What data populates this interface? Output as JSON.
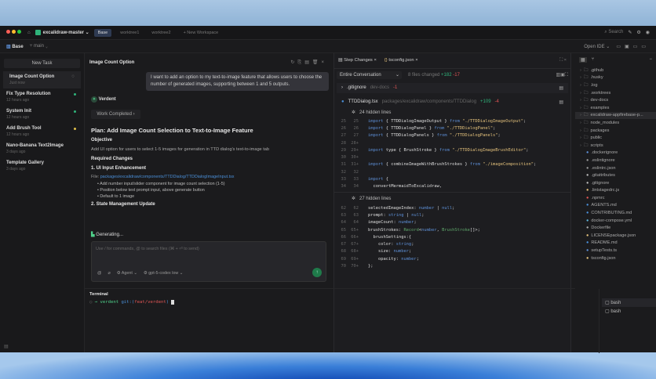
{
  "titlebar": {
    "repo": "excalidraw-master",
    "tabs": [
      "Base",
      "worktree1",
      "worktree2"
    ],
    "new_workspace": "+ New Workspace",
    "search": "Search"
  },
  "subheader": {
    "workspace": "Base",
    "branch": "main",
    "open_ide": "Open IDE"
  },
  "sidebar": {
    "new_task": "New Task",
    "tasks": [
      {
        "title": "Image Count Option",
        "time": "Just now",
        "status": "running"
      },
      {
        "title": "Fix Type Resolution",
        "time": "12 hours ago",
        "status": "#2fb37a"
      },
      {
        "title": "System Init",
        "time": "12 hours ago",
        "status": "#2fb37a"
      },
      {
        "title": "Add Brush Tool",
        "time": "12 hours ago",
        "status": "#e0c04a"
      },
      {
        "title": "Nano-Banana Text2Image",
        "time": "3 days ago"
      },
      {
        "title": "Template Gallery",
        "time": "3 days ago"
      }
    ]
  },
  "chat": {
    "title": "Image Count Option",
    "user_message": "I want to add an option to my text-to-image feature that allows users to choose the number of generated images, supporting between 1 and 5 outputs.",
    "agent": "Verdent",
    "work_completed": "Work Completed",
    "plan_title": "Plan: Add Image Count Selection to Text-to-Image Feature",
    "objective_h": "Objective",
    "objective": "Add UI option for users to select 1-5 images for generation in TTD dialog's text-to-image tab",
    "required_h": "Required Changes",
    "step1": "1. UI Input Enhancement",
    "file_label": "File:",
    "file_path": "packages/excalidraw/components/TTDDialog/TTDDialogImageInput.tsx",
    "bullets": [
      "Add number input/slider component for image count selection (1-5)",
      "Position below text prompt input, above generate button",
      "Default to 1 image"
    ],
    "step2": "2. State Management Update",
    "generating": "Generating...",
    "input_placeholder": "Use / for commands, @ to search files (⌘ + ⏎ to send)",
    "mode": "Agent",
    "model": "gpt-5-codex low"
  },
  "terminal": {
    "title": "Terminal",
    "prompt": "→ verdent",
    "git": "git:(feat/verdent)",
    "sessions": [
      "bash",
      "bash"
    ]
  },
  "diff": {
    "tabs": [
      "Step Changes",
      "tsconfig.json"
    ],
    "scope": "Entire Conversation",
    "files_changed": "8 files changed",
    "added": "+182",
    "removed": "-17",
    "file1": {
      "name": ".gitignore",
      "path": "dev-docs",
      "removed": "-1"
    },
    "file2": {
      "name": "TTDDialog.tsx",
      "path": "packages/excalidraw/components/TTDDialog",
      "added": "+109",
      "removed": "-4"
    },
    "hidden1": "24 hidden lines",
    "hidden2": "27 hidden lines",
    "block1": [
      [
        "25",
        "25",
        ""
      ],
      [
        "26",
        "26",
        ""
      ],
      [
        "27",
        "27",
        ""
      ],
      [
        "28",
        "28+",
        ""
      ],
      [
        "29",
        "29+",
        ""
      ],
      [
        "30",
        "30+",
        ""
      ],
      [
        "31",
        "31+",
        ""
      ],
      [
        "32",
        "32",
        ""
      ],
      [
        "33",
        "33",
        ""
      ],
      [
        "34",
        "34",
        ""
      ]
    ],
    "block2": [
      [
        "62",
        "62"
      ],
      [
        "63",
        "63"
      ],
      [
        "64",
        "64"
      ],
      [
        "65",
        "65+"
      ],
      [
        "66",
        "66+"
      ],
      [
        "67",
        "67+"
      ],
      [
        "68",
        "68+"
      ],
      [
        "69",
        "69+"
      ],
      [
        "70",
        "70+"
      ]
    ]
  },
  "tree": {
    "folders": [
      ".github",
      ".husky",
      ".log",
      ".worktrees",
      "dev-docs",
      "examples",
      "excalidraw-appfirebase-p...",
      "node_modules",
      "packages",
      "public",
      "scripts"
    ],
    "files": [
      ".dockerignore",
      ".eslintignore",
      ".eslintrc.json",
      ".gitattributes",
      ".gitignore",
      ".lintstagedrc.js",
      ".npmrc",
      "AGENTS.md",
      "CONTRIBUTING.md",
      "docker-compose.yml",
      "Dockerfile",
      "LICENSEpackage.json",
      "README.md",
      "setupTests.ts",
      "tsconfig.json"
    ]
  }
}
